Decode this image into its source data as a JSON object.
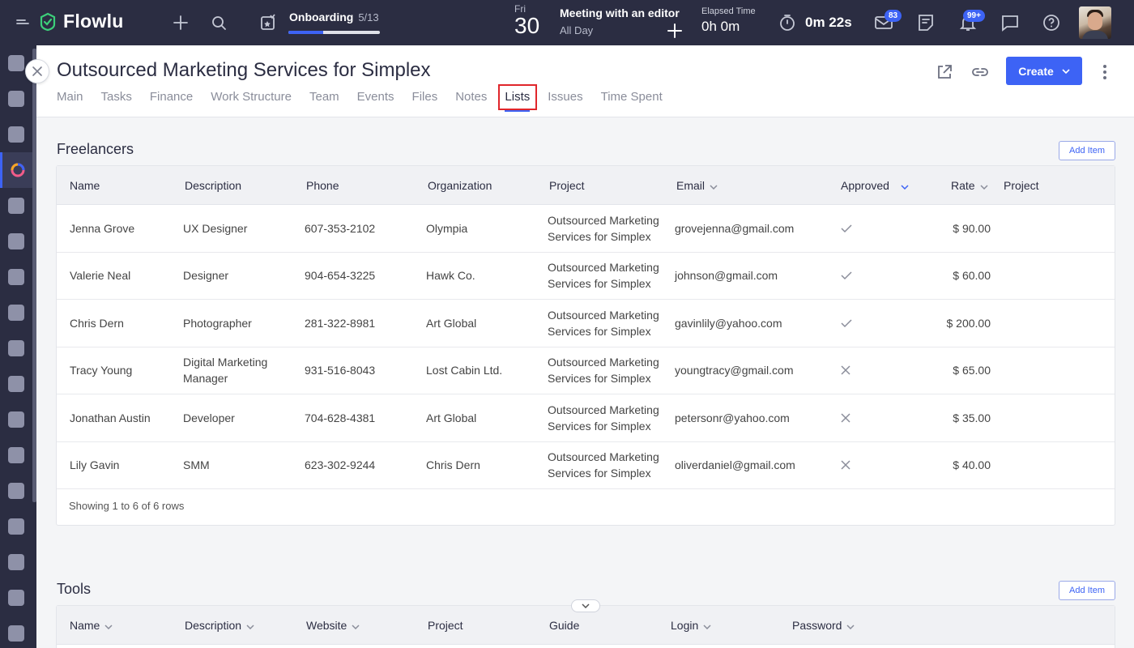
{
  "app": {
    "logo": "Flowlu"
  },
  "topbar": {
    "onboarding": {
      "title": "Onboarding",
      "count": "5/13",
      "progress": 0.38
    },
    "date": {
      "dow": "Fri",
      "day": "30"
    },
    "meeting": {
      "title": "Meeting with an editor",
      "sub": "All Day"
    },
    "elapsed": {
      "label": "Elapsed Time",
      "value": "0h 0m"
    },
    "timer": "0m 22s",
    "mail_badge": "83",
    "notif_badge": "99+"
  },
  "page": {
    "title": "Outsourced Marketing Services for Simplex",
    "tabs": [
      "Main",
      "Tasks",
      "Finance",
      "Work Structure",
      "Team",
      "Events",
      "Files",
      "Notes",
      "Lists",
      "Issues",
      "Time Spent"
    ],
    "active_tab": "Lists",
    "create_label": "Create"
  },
  "freelancers": {
    "title": "Freelancers",
    "add_label": "Add Item",
    "columns": [
      "Name",
      "Description",
      "Phone",
      "Organization",
      "Project",
      "Email",
      "Approved",
      "Rate",
      "Project"
    ],
    "rows": [
      {
        "name": "Jenna Grove",
        "description": "UX Designer",
        "phone": "607-353-2102",
        "organization": "Olympia",
        "project": "Outsourced Marketing Services for Simplex",
        "email": "grovejenna@gmail.com",
        "approved": true,
        "rate": "$ 90.00"
      },
      {
        "name": "Valerie Neal",
        "description": "Designer",
        "phone": "904-654-3225",
        "organization": "Hawk Co.",
        "project": "Outsourced Marketing Services for Simplex",
        "email": "johnson@gmail.com",
        "approved": true,
        "rate": "$ 60.00"
      },
      {
        "name": "Chris Dern",
        "description": "Photographer",
        "phone": "281-322-8981",
        "organization": "Art Global",
        "project": "Outsourced Marketing Services for Simplex",
        "email": "gavinlily@yahoo.com",
        "approved": true,
        "rate": "$ 200.00"
      },
      {
        "name": "Tracy Young",
        "description": "Digital Marketing Manager",
        "phone": "931-516-8043",
        "organization": "Lost Cabin Ltd.",
        "project": "Outsourced Marketing Services for Simplex",
        "email": "youngtracy@gmail.com",
        "approved": false,
        "rate": "$ 65.00"
      },
      {
        "name": "Jonathan Austin",
        "description": "Developer",
        "phone": "704-628-4381",
        "organization": "Art Global",
        "project": "Outsourced Marketing Services for Simplex",
        "email": "petersonr@yahoo.com",
        "approved": false,
        "rate": "$ 35.00"
      },
      {
        "name": "Lily Gavin",
        "description": "SMM",
        "phone": "623-302-9244",
        "organization": "Chris Dern",
        "project": "Outsourced Marketing Services for Simplex",
        "email": "oliverdaniel@gmail.com",
        "approved": false,
        "rate": "$ 40.00"
      }
    ],
    "footer": "Showing 1 to 6 of 6 rows"
  },
  "tools": {
    "title": "Tools",
    "add_label": "Add Item",
    "columns": [
      "Name",
      "Description",
      "Website",
      "Project",
      "Guide",
      "Login",
      "Password"
    ]
  },
  "colors": {
    "accent": "#3d63f5",
    "topbar": "#2b2d42",
    "highlight": "#e0262b"
  }
}
